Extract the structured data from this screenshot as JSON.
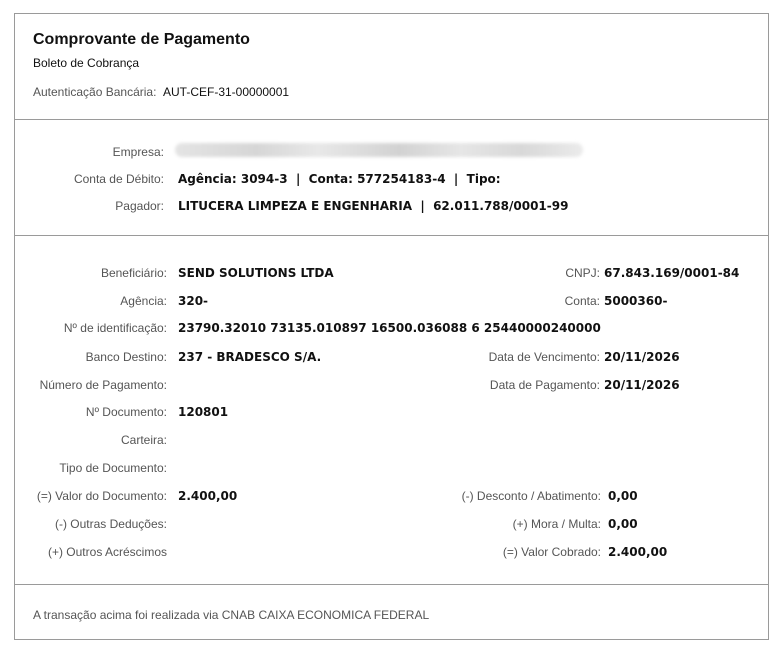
{
  "header": {
    "title": "Comprovante de Pagamento",
    "subtitle": "Boleto de Cobrança",
    "auth_label": "Autenticação Bancária:",
    "auth_value": "AUT-CEF-31-00000001"
  },
  "account": {
    "empresa_label": "Empresa:",
    "conta_label": "Conta de Débito:",
    "conta_value": "Agência: 3094-3  |  Conta: 577254183-4  |  Tipo:",
    "pagador_label": "Pagador:",
    "pagador_value": "LITUCERA LIMPEZA E ENGENHARIA  |  62.011.788/0001-99"
  },
  "details": {
    "left": [
      {
        "label": "Beneficiário:",
        "value": "SEND SOLUTIONS LTDA"
      },
      {
        "label": "Agência:",
        "value": "320-"
      },
      {
        "label": "Nº de identificação:",
        "value": "23790.32010 73135.010897 16500.036088 6 25440000240000"
      },
      {
        "label": "Banco Destino:",
        "value": "237 - BRADESCO S/A."
      },
      {
        "label": "Número de Pagamento:",
        "value": ""
      },
      {
        "label": "Nº Documento:",
        "value": "120801"
      },
      {
        "label": "Carteira:",
        "value": ""
      },
      {
        "label": "Tipo de Documento:",
        "value": ""
      },
      {
        "label": "(=) Valor do Documento:",
        "value": "2.400,00"
      },
      {
        "label": "(-) Outras Deduções:",
        "value": ""
      },
      {
        "label": "(+) Outros Acréscimos",
        "value": ""
      }
    ],
    "right": [
      {
        "label": "CNPJ:",
        "value": "67.843.169/0001-84"
      },
      {
        "label": "Conta:",
        "value": "5000360-"
      },
      {
        "label": "Data de Vencimento:",
        "value": "20/11/2026"
      },
      {
        "label": "Data de Pagamento:",
        "value": "20/11/2026"
      },
      {
        "label": "(-) Desconto / Abatimento:",
        "value": "0,00"
      },
      {
        "label": "(+) Mora / Multa:",
        "value": "0,00"
      },
      {
        "label": "(=) Valor Cobrado:",
        "value": "2.400,00"
      }
    ]
  },
  "footer": {
    "text": "A transação acima foi realizada via CNAB CAIXA ECONOMICA FEDERAL"
  }
}
